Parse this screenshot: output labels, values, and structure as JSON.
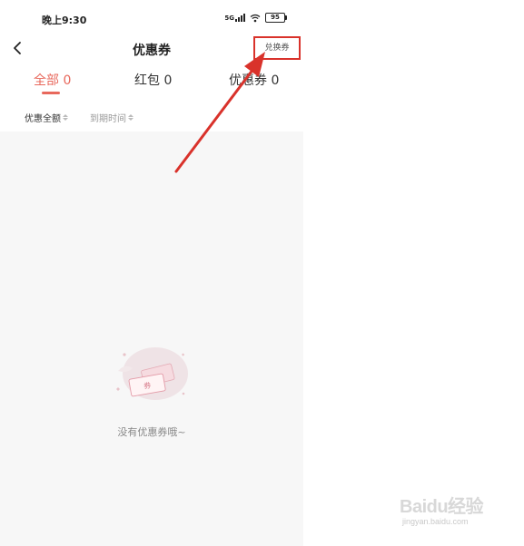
{
  "status_bar": {
    "time": "晚上9:30",
    "signal_label": "5G",
    "battery": "95"
  },
  "header": {
    "title": "优惠券",
    "redeem_label": "兑换券"
  },
  "tabs": [
    {
      "label": "全部 0",
      "active": true
    },
    {
      "label": "红包 0",
      "active": false
    },
    {
      "label": "优惠券 0",
      "active": false
    }
  ],
  "sort": [
    {
      "label": "优惠全额"
    },
    {
      "label": "到期时间"
    }
  ],
  "empty": {
    "message": "没有优惠券哦~",
    "illustration_label": "券"
  },
  "watermark": {
    "brand": "Baidu经验",
    "url": "jingyan.baidu.com"
  },
  "colors": {
    "accent": "#e8685c",
    "annotation": "#d9322b"
  }
}
